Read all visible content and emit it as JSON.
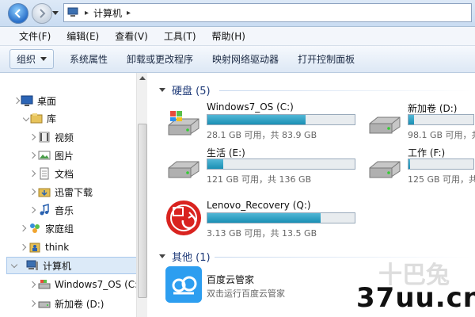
{
  "address": {
    "path": [
      "计算机"
    ]
  },
  "menu": [
    "文件(F)",
    "编辑(E)",
    "查看(V)",
    "工具(T)",
    "帮助(H)"
  ],
  "toolbar": {
    "organize": "组织",
    "buttons": [
      "系统属性",
      "卸载或更改程序",
      "映射网络驱动器",
      "打开控制面板"
    ]
  },
  "nav": {
    "desktop": "桌面",
    "library": "库",
    "video": "视频",
    "pictures": "图片",
    "documents": "文档",
    "thunder": "迅雷下载",
    "music": "音乐",
    "homegroup": "家庭组",
    "think": "think",
    "computer": "计算机",
    "drive_c": "Windows7_OS (C:)",
    "drive_d": "新加卷 (D:)"
  },
  "groups": {
    "disks": "硬盘 (5)",
    "others": "其他 (1)"
  },
  "drives": [
    {
      "name": "Windows7_OS (C:)",
      "free": "28.1 GB 可用，共 83.9 GB",
      "used_fraction": 0.665
    },
    {
      "name": "新加卷 (D:)",
      "free": "98.1 GB 可用，共 ",
      "used_fraction": 0.09
    },
    {
      "name": "生活 (E:)",
      "free": "121 GB 可用，共 136 GB",
      "used_fraction": 0.11
    },
    {
      "name": "工作 (F:)",
      "free": "125 GB 可用，共 ",
      "used_fraction": 0.03
    },
    {
      "name": "Lenovo_Recovery (Q:)",
      "free": "3.13 GB 可用，共 13.5 GB",
      "used_fraction": 0.77
    }
  ],
  "app": {
    "name": "百度云管家",
    "desc": "双击运行百度云管家"
  },
  "watermark": {
    "main": "37uu.cn",
    "cn": "十巴兔"
  },
  "colors": {
    "accent": "#1e3a78",
    "bar": "#1a8fb4",
    "selection": "#dceaf8"
  }
}
